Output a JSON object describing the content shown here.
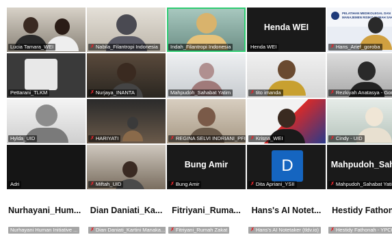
{
  "participants": [
    {
      "name": "Lucia Tamara_WEI",
      "muted": false
    },
    {
      "name": "Nabila_Filantropi Indonesia",
      "muted": true
    },
    {
      "name": "Indah_Filantropi Indonesia",
      "muted": false,
      "active": true
    },
    {
      "name": "Henda WEI",
      "muted": false,
      "video_off": true,
      "display": "Henda WEI"
    },
    {
      "name": "Hans_Arief_goroba",
      "muted": true,
      "banner": "PELATIHAN MEDIKOLEGAL DAN MANAJEMEN RISIKO RUMAH SAKIT"
    },
    {
      "name": "Pettarani_TLKM",
      "muted": false
    },
    {
      "name": "Nurjaya_INANTA",
      "muted": true
    },
    {
      "name": "Mahpudoh_Sahabat Yatim",
      "muted": false
    },
    {
      "name": "tito imanda",
      "muted": true
    },
    {
      "name": "Rezkiyah Anatasya - Gorobak",
      "muted": true
    },
    {
      "name": "Hylda_UID",
      "muted": false
    },
    {
      "name": "HARIYATI",
      "muted": true
    },
    {
      "name": "REGINA SELVI INDRIANI_PFI",
      "muted": true
    },
    {
      "name": "Krisna_WEI",
      "muted": true
    },
    {
      "name": "Cindy - UID",
      "muted": true
    },
    {
      "name": "Adri",
      "muted": false
    },
    {
      "name": "Miftah_UID",
      "muted": true
    },
    {
      "name": "Bung Amir",
      "muted": true,
      "video_off": true,
      "display": "Bung Amir"
    },
    {
      "name": "Dita Apriani_YSII",
      "muted": true,
      "avatar_letter": "D"
    },
    {
      "name": "Mahpudoh_Sahabat Yatim",
      "muted": true,
      "video_off": true,
      "display": "Mahpudoh_Sah..."
    },
    {
      "name": "Nurhayani Human Initiative ...",
      "muted": false,
      "video_off": true,
      "display": "Nurhayani_Hum..."
    },
    {
      "name": "Dian Daniati_Kartini Manaka...",
      "muted": true,
      "video_off": true,
      "display": "Dian Daniati_Ka..."
    },
    {
      "name": "Fitriyani_Rumah Zakat",
      "muted": true,
      "video_off": true,
      "display": "Fitriyani_Ruma..."
    },
    {
      "name": "Hans's AI Notetaker (tldv.io)",
      "muted": true,
      "video_off": true,
      "display": "Hans's AI Notet..."
    },
    {
      "name": "Hestidy Fathonah - YPCII",
      "muted": true,
      "video_off": true,
      "display": "Hestidy Fathon..."
    }
  ],
  "colors": {
    "mic_muted": "#e0252b",
    "active_border": "#2ecc71",
    "avatar_bg": "#1565c0"
  }
}
